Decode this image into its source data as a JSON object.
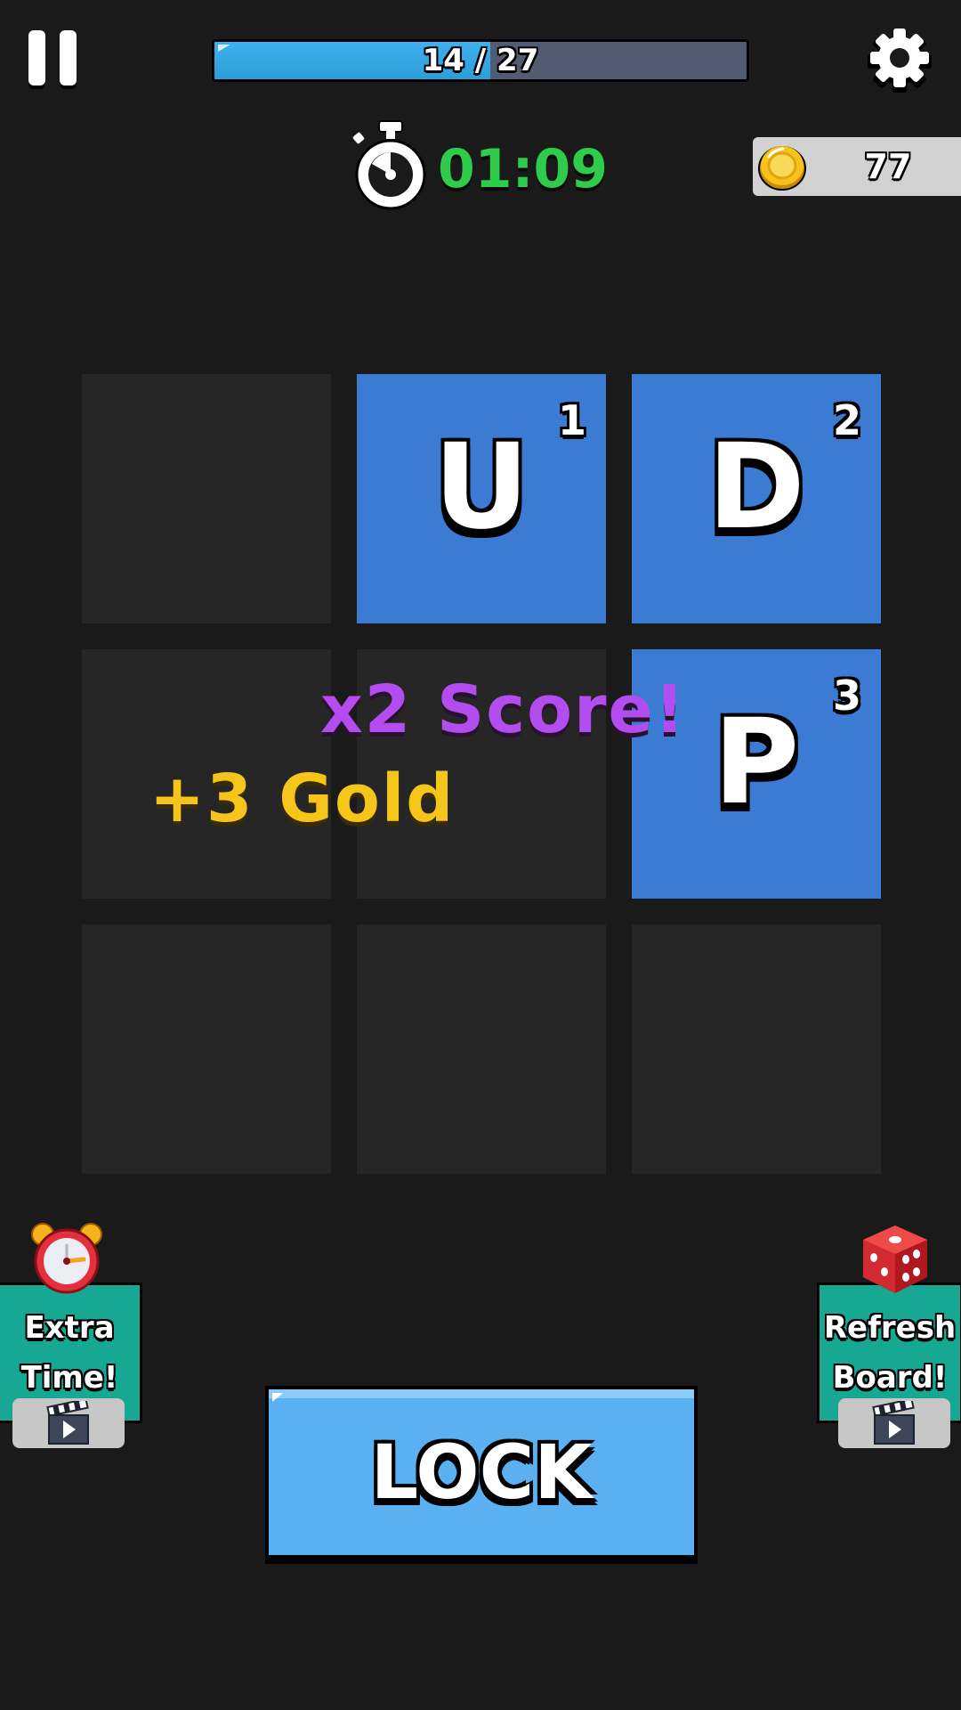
{
  "hud": {
    "progress": {
      "current": 14,
      "total": 27,
      "label": "14 / 27"
    },
    "timer": "01:09",
    "gold": "77"
  },
  "board": {
    "rows": 3,
    "cols": 3,
    "cells": [
      {
        "letter": "",
        "number": ""
      },
      {
        "letter": "U",
        "number": "1"
      },
      {
        "letter": "D",
        "number": "2"
      },
      {
        "letter": "",
        "number": ""
      },
      {
        "letter": "",
        "number": ""
      },
      {
        "letter": "P",
        "number": "3"
      },
      {
        "letter": "",
        "number": ""
      },
      {
        "letter": "",
        "number": ""
      },
      {
        "letter": "",
        "number": ""
      }
    ]
  },
  "popups": {
    "score": "x2 Score!",
    "gold": "+3 Gold"
  },
  "powerups": {
    "extra_time": {
      "line1": "Extra",
      "line2": "Time!"
    },
    "refresh_board": {
      "line1": "Refresh",
      "line2": "Board!"
    }
  },
  "actions": {
    "lock": "LOCK"
  },
  "colors": {
    "background": "#1a1a1a",
    "empty_cell": "#262626",
    "filled_cell": "#3b7bd4",
    "timer_green": "#2ecc4a",
    "score_purple": "#b44df0",
    "gold_yellow": "#f6c51a",
    "powerup_teal": "#17a894",
    "lock_blue": "#5ab0f0"
  },
  "icons": {
    "pause": "pause-icon",
    "settings": "gear-icon",
    "timer": "stopwatch-icon",
    "gold": "coin-icon",
    "extra_time": "alarm-clock-icon",
    "refresh": "dice-icon",
    "video": "clapperboard-icon"
  }
}
